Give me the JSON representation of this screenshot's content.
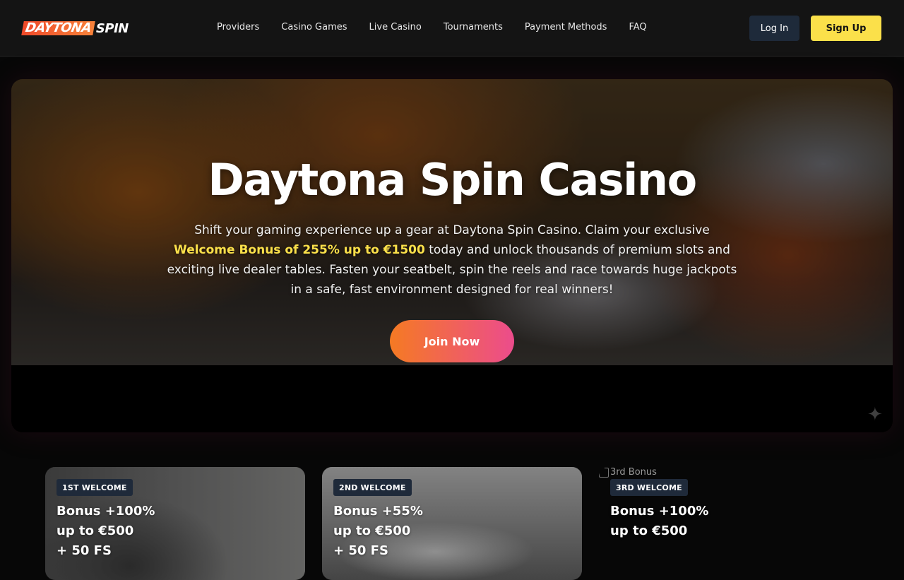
{
  "header": {
    "logo": {
      "part1": "DAYTONA",
      "part2": "SPIN"
    },
    "nav": [
      "Providers",
      "Casino Games",
      "Live Casino",
      "Tournaments",
      "Payment Methods",
      "FAQ"
    ],
    "login_label": "Log In",
    "signup_label": "Sign Up"
  },
  "hero": {
    "title": "Daytona Spin Casino",
    "text_before": "Shift your gaming experience up a gear at Daytona Spin Casino. Claim your exclusive ",
    "text_highlight": "Welcome Bonus of 255% up to €1500",
    "text_after": " today and unlock thousands of premium slots and exciting live dealer tables. Fasten your seatbelt, spin the reels and race towards huge jackpots in a safe, fast environment designed for real winners!",
    "cta_label": "Join Now"
  },
  "bonuses": [
    {
      "badge": "1ST WELCOME",
      "text": "Bonus +100%\nup to €500\n+ 50 FS"
    },
    {
      "badge": "2ND WELCOME",
      "text": "Bonus +55%\nup to €500\n+ 50 FS"
    },
    {
      "badge": "3RD WELCOME",
      "text": "Bonus +100%\nup to €500",
      "image_alt": "3rd Bonus"
    }
  ],
  "colors": {
    "accent_yellow": "#fbe04a",
    "cta_gradient_start": "#f57a23",
    "cta_gradient_end": "#ec4c8c",
    "login_bg": "#1e2a3a",
    "header_bg": "#141414"
  }
}
